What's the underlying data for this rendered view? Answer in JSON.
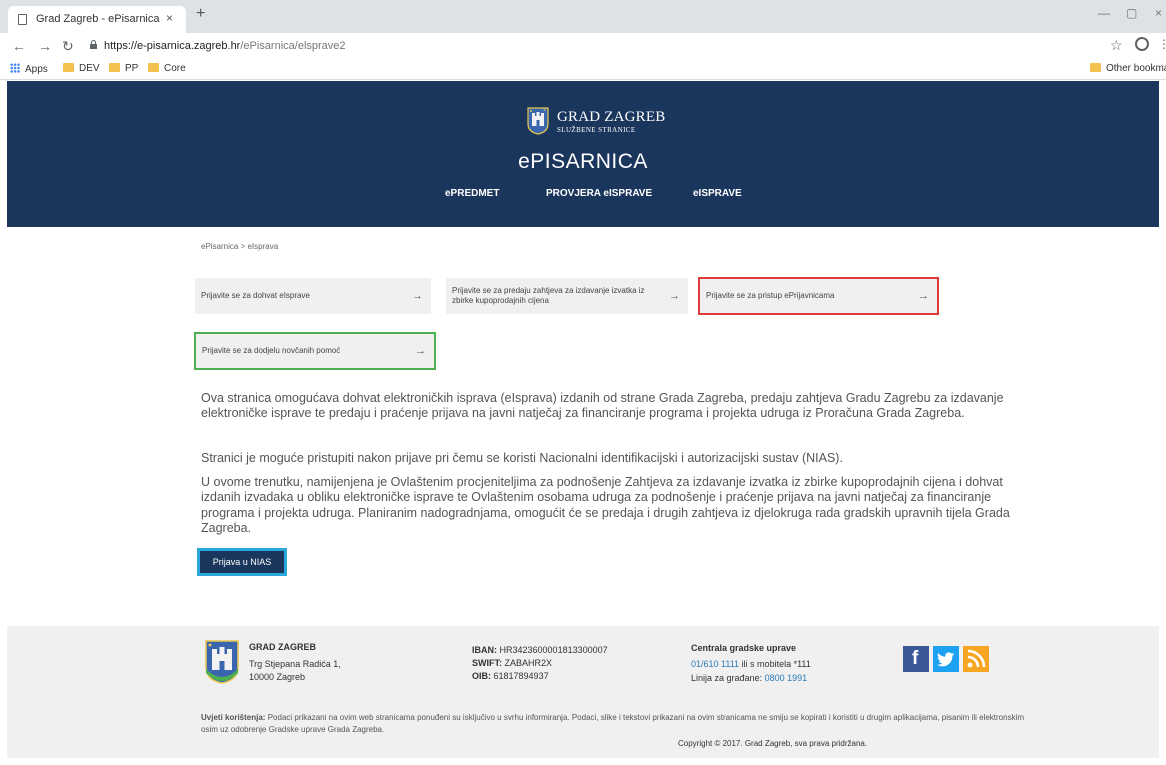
{
  "browser": {
    "tab_title": "Grad Zagreb - ePisarnica",
    "tab_close": "×",
    "new_tab": "+",
    "url_host": "https://e-pisarnica.zagreb.hr",
    "url_path": "/ePisarnica/elsprave2",
    "bookmarks": {
      "apps": "Apps",
      "dev": "DEV",
      "pp": "PP",
      "core": "Core",
      "other": "Other bookmark"
    }
  },
  "header": {
    "brand_name": "GRAD ZAGREB",
    "brand_sub": "SLUŽBENE STRANICE",
    "app_title": "ePISARNICA",
    "nav": {
      "epredmet": "ePREDMET",
      "provjera": "PROVJERA eISPRAVE",
      "eisprave": "eISPRAVE"
    }
  },
  "breadcrumb": "ePisarnica > eIsprava",
  "cards": {
    "dohvat": "Prijavite se za dohvat eIsprave",
    "izvadak": "Prijavite se za predaju zahtjeva za izdavanje izvatka iz zbirke kupoprodajnih cijena",
    "prijavnice": "Prijavite se za pristup ePrijavnicama",
    "novcana": "Prijavite se za dodjelu novčanih pomoć",
    "arrow": "→"
  },
  "intro": {
    "p1": "Ova stranica omogućava dohvat elektroničkih isprava (eIsprava) izdanih od strane Grada Zagreba, predaju zahtjeva Gradu Zagrebu za izdavanje elektroničke isprave te predaju i praćenje prijava na javni natječaj za financiranje programa i projekta udruga iz Proračuna Grada Zagreba.",
    "p2": "Stranici je moguće pristupiti nakon prijave pri čemu se koristi Nacionalni identifikacijski i autorizacijski sustav (NIAS).",
    "p3": "U ovome trenutku, namijenjena je Ovlaštenim procjeniteljima za podnošenje Zahtjeva za izdavanje izvatka iz zbirke kupoprodajnih cijena i dohvat izdanih izvadaka u obliku elektroničke isprave te Ovlaštenim osobama udruga za podnošenje i praćenje prijava na javni natječaj za financiranje programa i projekta udruga. Planiranim nadogradnjama, omogućit će se predaja i drugih zahtjeva iz djelokruga rada gradskih upravnih tijela Grada Zagreba.",
    "button": "Prijava u NIAS"
  },
  "footer": {
    "org_name": "GRAD ZAGREB",
    "address1": "Trg Stjepana Radića 1,",
    "address2": "10000 Zagreb",
    "iban_label": "IBAN:",
    "iban": "HR3423600001813300007",
    "swift_label": "SWIFT:",
    "swift": "ZABAHR2X",
    "oib_label": "OIB:",
    "oib": "61817894937",
    "central_title": "Centrala gradske uprave",
    "central_phone": "01/610 1111",
    "central_mobile": "ili s mobitela *111",
    "citizens_label": "Linija za građane:",
    "citizens_phone": "0800 1991",
    "terms_label": "Uvjeti korištenja:",
    "terms": "Podaci prikazani na ovim web stranicama ponuđeni su isključivo u svrhu informiranja. Podaci, slike i tekstovi prikazani na ovim stranicama ne smiju se kopirati i koristiti u drugim aplikacijama, pisanim ili elektronskim osim uz odobrenje Gradske uprave Grada Zagreba.",
    "copyright": "Copyright © 2017. Grad Zagreb, sva prava pridržana.",
    "social_fb": "f",
    "social_rss": "RSS"
  },
  "colors": {
    "header_bg": "#1b365d",
    "highlight_red": "#e03b3b",
    "highlight_green": "#4caf50",
    "button_border": "#2aa7d9"
  }
}
